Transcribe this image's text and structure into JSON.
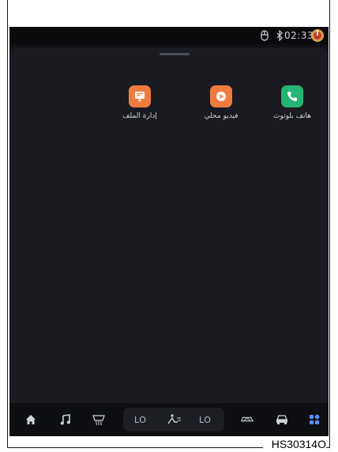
{
  "status_bar": {
    "time": "02:33",
    "icons": [
      "mouse-icon",
      "bluetooth-icon",
      "power-icon"
    ]
  },
  "apps": [
    {
      "label": "هاتف بلوتوث",
      "icon": "phone-icon",
      "color": "#22b573"
    },
    {
      "label": "فيديو محلي",
      "icon": "video-play-icon",
      "color": "#f07b3f"
    },
    {
      "label": "إدارة الملف",
      "icon": "file-manager-icon",
      "color": "#f07b3f"
    }
  ],
  "dock": {
    "left_temp": "LO",
    "right_temp": "LO",
    "buttons": [
      "home-icon",
      "music-icon",
      "defrost-icon",
      "fan-airflow-icon",
      "recirculation-icon",
      "car-icon",
      "apps-grid-icon"
    ],
    "active_color": "#5b8dff"
  },
  "document_code": "HS30314O"
}
